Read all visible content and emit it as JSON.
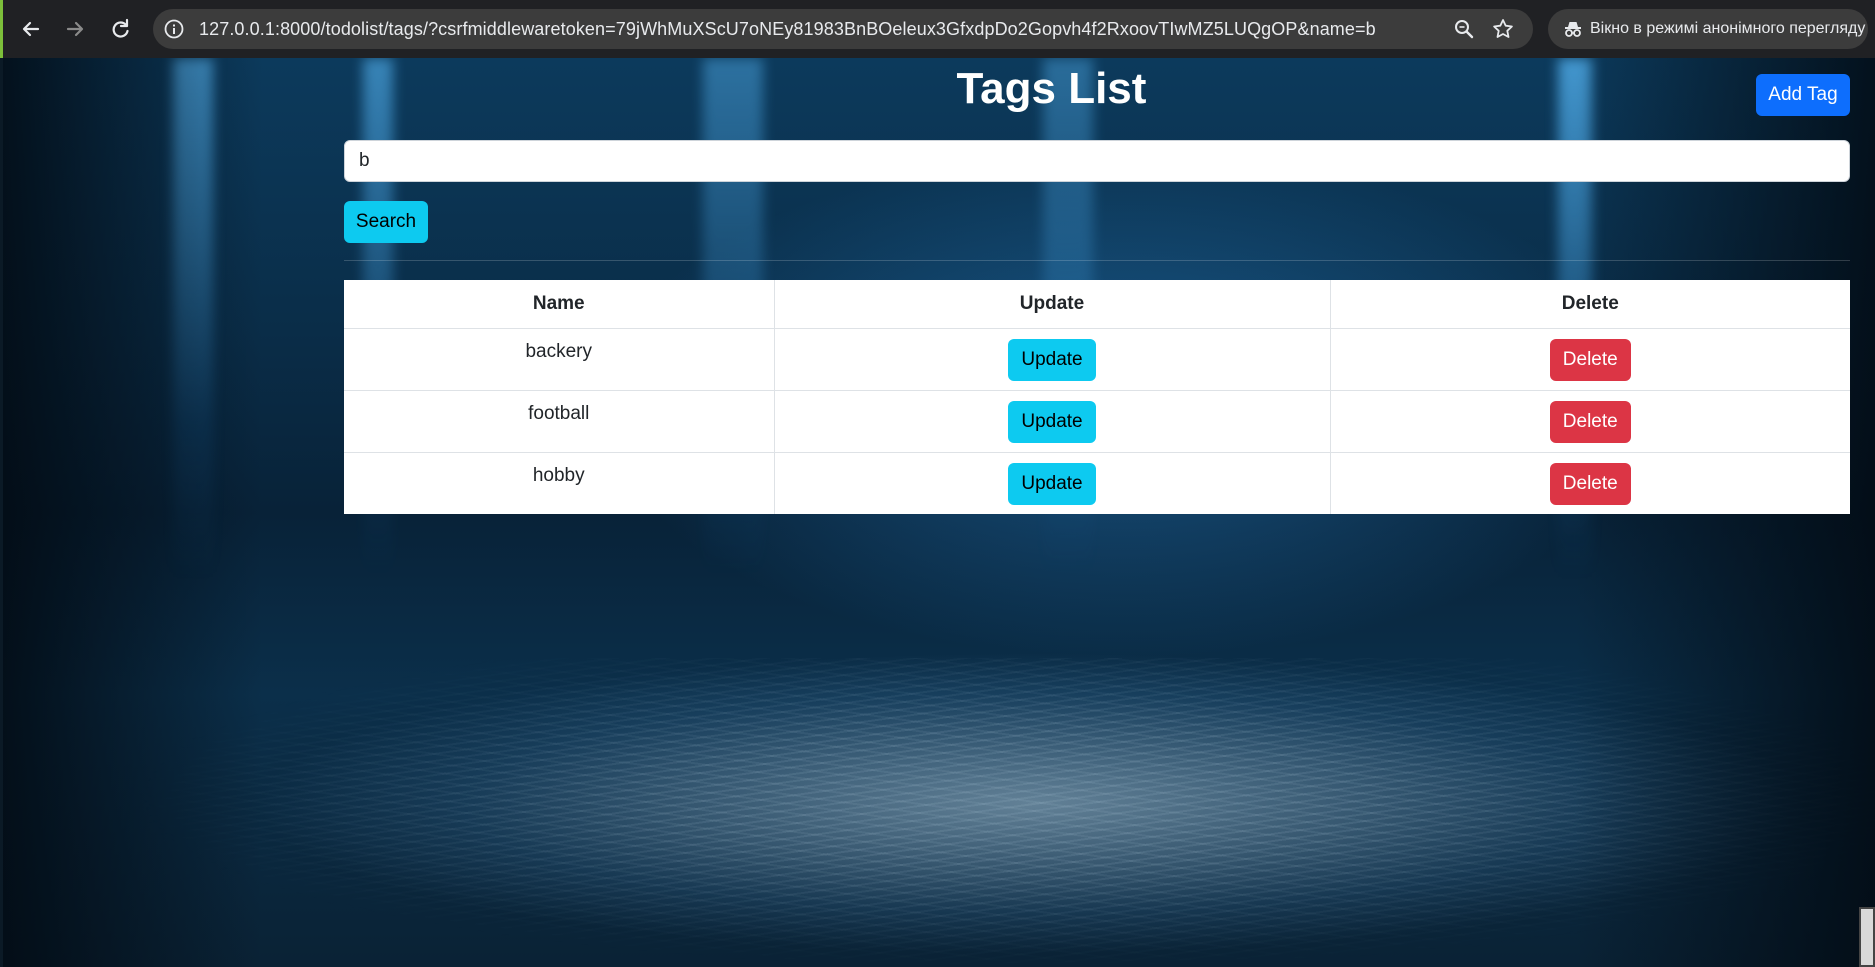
{
  "browser": {
    "url": "127.0.0.1:8000/todolist/tags/?csrfmiddlewaretoken=79jWhMuXScU7oNEy81983BnBOeleux3GfxdpDo2Gopvh4f2RxoovTIwMZ5LUQgOP&name=b",
    "incognito_label": "Вікно в режимі анонімного перегляду",
    "icons": [
      "back-arrow-icon",
      "forward-arrow-icon",
      "reload-icon",
      "site-info-icon",
      "zoom-icon",
      "bookmark-star-icon",
      "incognito-icon"
    ]
  },
  "page": {
    "title": "Tags List",
    "add_tag_label": "Add Tag",
    "search": {
      "value": "b",
      "button_label": "Search"
    },
    "table": {
      "headers": [
        "Name",
        "Update",
        "Delete"
      ],
      "update_label": "Update",
      "delete_label": "Delete",
      "rows": [
        {
          "name": "backery"
        },
        {
          "name": "football"
        },
        {
          "name": "hobby"
        }
      ]
    }
  },
  "colors": {
    "primary": "#0d6efd",
    "info": "#0dcaf0",
    "danger": "#dc3545"
  }
}
